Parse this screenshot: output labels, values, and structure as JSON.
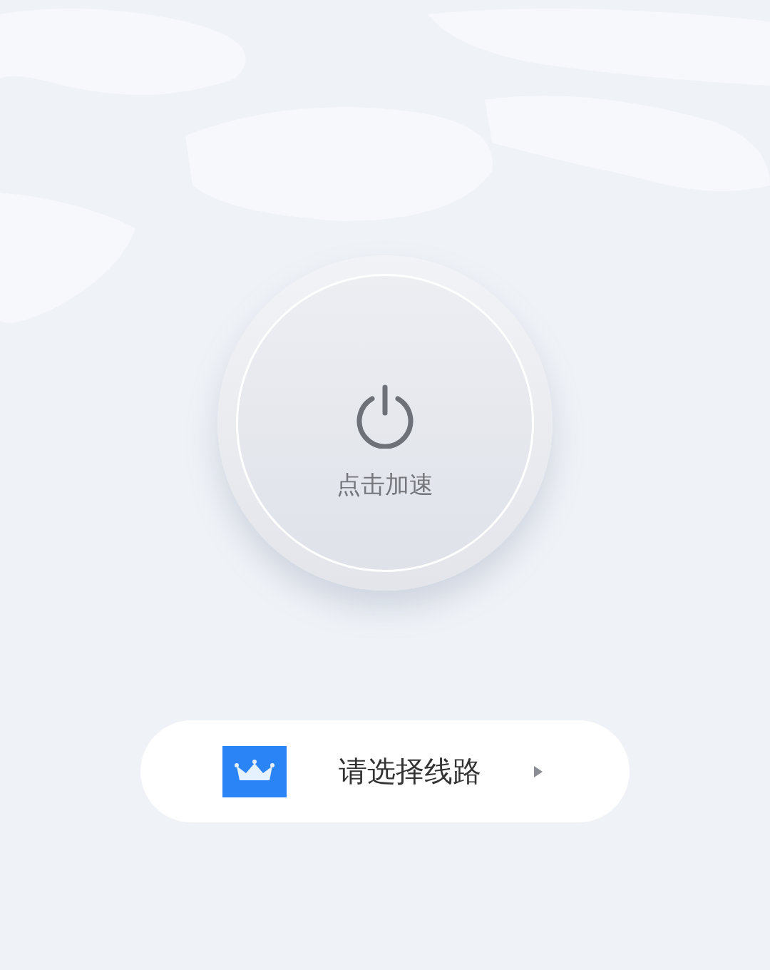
{
  "power_button": {
    "label": "点击加速"
  },
  "route_selector": {
    "label": "请选择线路"
  }
}
